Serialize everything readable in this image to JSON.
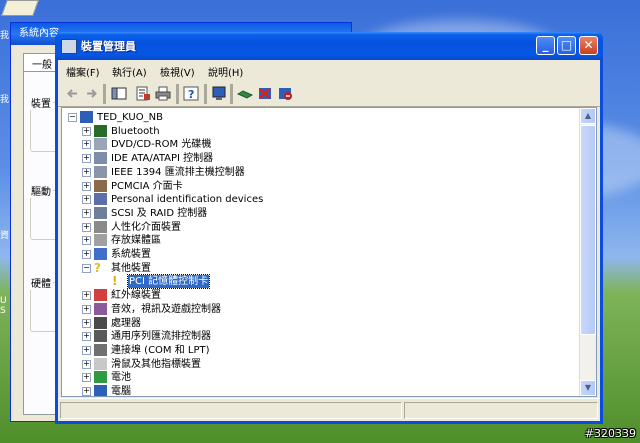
{
  "background_window": {
    "title": "系統內容",
    "tab_label": "一般",
    "group_labels": [
      "裝置",
      "驅動",
      "硬體"
    ],
    "left_edge_text": [
      "我",
      "我",
      "資",
      "U S"
    ]
  },
  "window": {
    "title": "裝置管理員",
    "buttons": {
      "minimize": "_",
      "maximize": "□",
      "close": "✕"
    }
  },
  "menu": [
    "檔案(F)",
    "執行(A)",
    "檢視(V)",
    "說明(H)"
  ],
  "toolbar_icons": [
    "back-icon",
    "forward-icon",
    "console-tree-icon",
    "properties-icon",
    "print-icon",
    "help-icon",
    "scan-hardware-icon",
    "update-driver-icon",
    "uninstall-icon",
    "disable-icon"
  ],
  "tree": {
    "root": "TED_KUO_NB",
    "items": [
      {
        "label": "Bluetooth",
        "icon": "bluetooth-icon",
        "expander": "+",
        "level": 1
      },
      {
        "label": "DVD/CD-ROM 光碟機",
        "icon": "cdrom-icon",
        "expander": "+",
        "level": 1
      },
      {
        "label": "IDE ATA/ATAPI 控制器",
        "icon": "ide-icon",
        "expander": "+",
        "level": 1
      },
      {
        "label": "IEEE 1394 匯流排主機控制器",
        "icon": "firewire-icon",
        "expander": "+",
        "level": 1
      },
      {
        "label": "PCMCIA 介面卡",
        "icon": "pcmcia-icon",
        "expander": "+",
        "level": 1
      },
      {
        "label": "Personal identification devices",
        "icon": "fingerprint-icon",
        "expander": "+",
        "level": 1
      },
      {
        "label": "SCSI 及 RAID 控制器",
        "icon": "scsi-icon",
        "expander": "+",
        "level": 1
      },
      {
        "label": "人性化介面裝置",
        "icon": "hid-icon",
        "expander": "+",
        "level": 1
      },
      {
        "label": "存放媒體區",
        "icon": "storage-icon",
        "expander": "+",
        "level": 1
      },
      {
        "label": "系統裝置",
        "icon": "system-icon",
        "expander": "+",
        "level": 1
      },
      {
        "label": "其他裝置",
        "icon": "unknown-device-icon",
        "expander": "−",
        "level": 1
      },
      {
        "label": "PCI 記憶體控制卡",
        "icon": "warning-device-icon",
        "expander": "",
        "level": 2,
        "selected": true
      },
      {
        "label": "紅外線裝置",
        "icon": "infrared-icon",
        "expander": "+",
        "level": 1
      },
      {
        "label": "音效，視訊及遊戲控制器",
        "icon": "sound-icon",
        "expander": "+",
        "level": 1
      },
      {
        "label": "處理器",
        "icon": "processor-icon",
        "expander": "+",
        "level": 1
      },
      {
        "label": "通用序列匯流排控制器",
        "icon": "usb-icon",
        "expander": "+",
        "level": 1
      },
      {
        "label": "連接埠 (COM 和 LPT)",
        "icon": "port-icon",
        "expander": "+",
        "level": 1
      },
      {
        "label": "滑鼠及其他指標裝置",
        "icon": "mouse-icon",
        "expander": "+",
        "level": 1
      },
      {
        "label": "電池",
        "icon": "battery-icon",
        "expander": "+",
        "level": 1
      },
      {
        "label": "電腦",
        "icon": "computer-icon",
        "expander": "+",
        "level": 1
      }
    ]
  },
  "watermark": "#320339",
  "colors": {
    "titlebar": "#0552de",
    "selection": "#316ac5",
    "window_bg": "#ece9d8"
  }
}
